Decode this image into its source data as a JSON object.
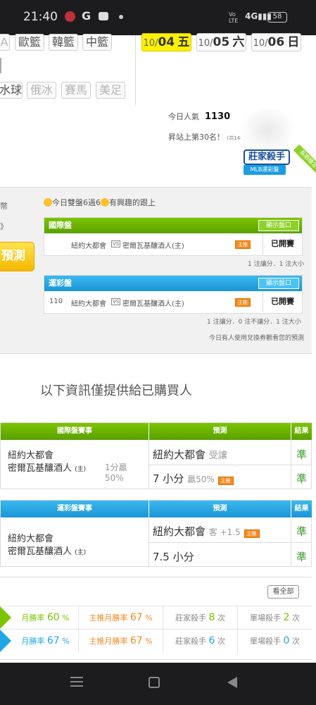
{
  "status_bar": {
    "time": "21:40",
    "battery": "58",
    "signal_text": "Vo LTE 4G"
  },
  "league_chips": [
    {
      "label": "A",
      "disabled": true
    },
    {
      "label": "歐籃",
      "disabled": false
    },
    {
      "label": "韓籃",
      "disabled": false
    },
    {
      "label": "中籃",
      "disabled": false
    },
    {
      "label": "水球",
      "disabled": false
    },
    {
      "label": "俄冰",
      "disabled": true
    },
    {
      "label": "賽馬",
      "disabled": true
    },
    {
      "label": "美足",
      "disabled": true
    }
  ],
  "dates": [
    {
      "prefix": "10/",
      "day": "04",
      "weekday": "五",
      "active": true
    },
    {
      "prefix": "10/",
      "day": "05",
      "weekday": "六",
      "active": false
    },
    {
      "prefix": "10/",
      "day": "06",
      "weekday": "日",
      "active": false
    }
  ],
  "visitors": {
    "label": "今日人氣",
    "count": "1130",
    "rank_text": "昇站上第30名！",
    "rank_small": "(共14424人)"
  },
  "badge": {
    "title": "莊家殺手",
    "subtitle": "MLB運彩盤",
    "ribbon": "長期穩定"
  },
  "panel": {
    "left_text_1": "幣",
    "left_text_2": "》",
    "predict_button": "預測",
    "note": "今日雙盤6過6",
    "note_suffix": "有興趣的跟上",
    "intl": {
      "header": "國際盤",
      "show_btn": "顯示盤口",
      "row": {
        "num": "",
        "team_a": "紐約大都會",
        "vs": "VS",
        "team_b": "密爾瓦基釀酒人(主)",
        "tag": "主推",
        "status": "已開賽"
      },
      "footnote": "1 注讓分．1 注大小"
    },
    "sports": {
      "header": "運彩盤",
      "show_btn": "顯示盤口",
      "row": {
        "num": "110",
        "team_a": "紐約大都會",
        "vs": "VS",
        "team_b": "密爾瓦基釀酒人(主)",
        "tag": "主推",
        "status": "已開賽"
      },
      "footnote": "1 注讓分．0 注不讓分．1 注大小",
      "footnote2": "今日有人使用兌換券觀看您的預測"
    }
  },
  "section_title": "以下資訊僅提供給已購買人",
  "intl_table": {
    "headers": {
      "match": "國際盤賽事",
      "predict": "預測",
      "result": "結果"
    },
    "team_a": "紐約大都會",
    "team_b": "密爾瓦基釀酒人",
    "home_mark": "(主)",
    "score_1": "1分贏",
    "score_2": "50%",
    "rows": [
      {
        "pick": "紐約大都會",
        "extra": "受讓",
        "tag": "",
        "result": "準"
      },
      {
        "pick": "7 小分",
        "extra": "贏50%",
        "tag": "主推",
        "result": "準"
      }
    ]
  },
  "sports_table": {
    "headers": {
      "match": "運彩盤賽事",
      "predict": "預測",
      "result": "結果"
    },
    "team_a": "紐約大都會",
    "team_b": "密爾瓦基釀酒人",
    "home_mark": "(主)",
    "rows": [
      {
        "pick": "紐約大都會",
        "extra": "客 +1.5",
        "tag": "主推",
        "result": "準"
      },
      {
        "pick": "7.5 小分",
        "extra": "",
        "tag": "",
        "result": "準"
      }
    ]
  },
  "stats": {
    "see_all": "看全部",
    "rows": [
      {
        "color": "#7cc400",
        "month_label": "月勝率",
        "month_val": "60",
        "main_label": "主推月勝率",
        "main_val": "67",
        "banker_label": "莊家殺手",
        "banker_val": "8",
        "single_label": "單場殺手",
        "single_val": "2",
        "pct": "%",
        "times": "次"
      },
      {
        "color": "#1ea7e8",
        "month_label": "月勝率",
        "month_val": "67",
        "main_label": "主推月勝率",
        "main_val": "67",
        "banker_label": "莊家殺手",
        "banker_val": "6",
        "single_label": "單場殺手",
        "single_val": "0",
        "pct": "%",
        "times": "次"
      }
    ]
  }
}
